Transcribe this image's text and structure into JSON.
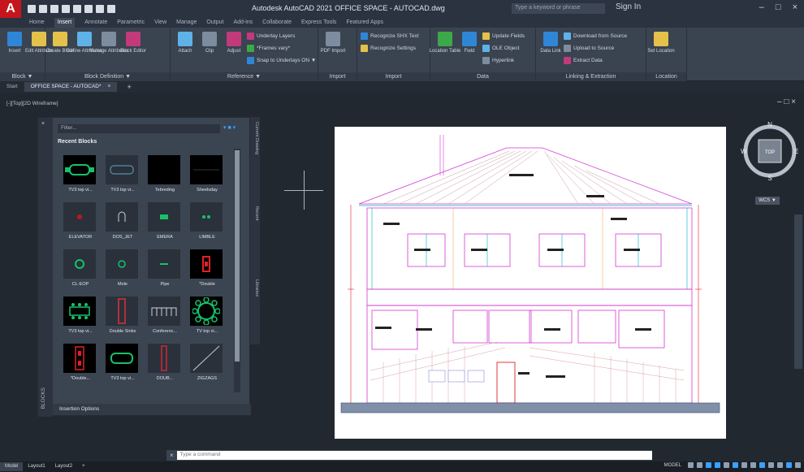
{
  "app": {
    "logo_letter": "A",
    "title": "Autodesk AutoCAD 2021   OFFICE SPACE - AUTOCAD.dwg",
    "search_placeholder": "Type a keyword or phrase",
    "signin": "Sign In",
    "window_controls": [
      "–",
      "□",
      "×"
    ]
  },
  "ribbon_tabs": [
    "Home",
    "Insert",
    "Annotate",
    "Parametric",
    "View",
    "Manage",
    "Output",
    "Add-ins",
    "Collaborate",
    "Express Tools",
    "Featured Apps"
  ],
  "active_ribbon_tab": "Insert",
  "ribbon_groups": [
    {
      "label": "Block ▼",
      "buttons": [
        "Insert",
        "Edit Attribute"
      ]
    },
    {
      "label": "Block Definition ▼",
      "buttons": [
        "Create Block",
        "Define Attributes",
        "Manage Attributes",
        "Block Editor"
      ]
    },
    {
      "label": "Reference ▼",
      "buttons": [
        "Attach",
        "Clip",
        "Adjust"
      ],
      "small": [
        "Underlay Layers",
        "*Frames vary*",
        "Snap to Underlays ON ▼"
      ]
    },
    {
      "label": "Import",
      "buttons": [
        "PDF Import"
      ]
    },
    {
      "label": "Import",
      "small": [
        "Recognize SHX Text",
        "Recognize Settings"
      ]
    },
    {
      "label": "Data",
      "buttons": [
        "Location Table",
        "Field"
      ],
      "small": [
        "Update Fields",
        "OLE Object",
        "Hyperlink"
      ]
    },
    {
      "label": "Linking & Extraction",
      "buttons": [
        "Data Link"
      ],
      "small": [
        "Download from Source",
        "Upload to Source",
        "Extract Data"
      ]
    },
    {
      "label": "Location",
      "buttons": [
        "Set Location"
      ]
    }
  ],
  "file_tabs": {
    "start": "Start",
    "active": "OFFICE SPACE - AUTOCAD*",
    "close": "×",
    "add": "+"
  },
  "viewport_label": "[-][Top][2D Wireframe]",
  "viewport_ctrl": "– □ ×",
  "blocks_palette": {
    "close": "×",
    "title": "BLOCKS",
    "filter_placeholder": "Filter...",
    "section": "Recent Blocks",
    "insertion_options": "Insertion Options",
    "side_tabs": [
      "Current Drawing",
      "Recent",
      "Libraries"
    ],
    "blocks": [
      {
        "label": "TV3 top vi...",
        "icon": "sofa-top",
        "dark": true
      },
      {
        "label": "TV3 top vi...",
        "icon": "sofa-top-alt",
        "dark": false
      },
      {
        "label": "Tebreding",
        "icon": "blank",
        "dark": true
      },
      {
        "label": "Sheelsday",
        "icon": "blank-line",
        "dark": true
      },
      {
        "label": "ELEVATOR",
        "icon": "elevator",
        "dark": false
      },
      {
        "label": "DOS_JET",
        "icon": "door-jet",
        "dark": false
      },
      {
        "label": "EMERA",
        "icon": "camera-mark",
        "dark": false
      },
      {
        "label": "LIMBLE",
        "icon": "dots",
        "dark": false
      },
      {
        "label": "CL-EOP",
        "icon": "ring",
        "dark": false
      },
      {
        "label": "Mole",
        "icon": "ring-small",
        "dark": false
      },
      {
        "label": "Pipe",
        "icon": "pipe",
        "dark": false
      },
      {
        "label": "*Double",
        "icon": "red-block",
        "dark": true
      },
      {
        "label": "TV3 top vi...",
        "icon": "table-green",
        "dark": true
      },
      {
        "label": "Double Sinks",
        "icon": "sink-red",
        "dark": false
      },
      {
        "label": "Conferenc...",
        "icon": "chair-row",
        "dark": false
      },
      {
        "label": "TV top vi...",
        "icon": "round-table",
        "dark": true
      },
      {
        "label": "*Double...",
        "icon": "red-double",
        "dark": true
      },
      {
        "label": "TV3 top vi...",
        "icon": "sofa-green",
        "dark": true
      },
      {
        "label": "DOUB...",
        "icon": "red-column",
        "dark": false
      },
      {
        "label": "ZIGZAGS",
        "icon": "diagonal",
        "dark": false
      }
    ]
  },
  "wcs_label": "WCS ▼",
  "viewcube": {
    "north": "N",
    "south": "S",
    "west": "W",
    "east": "E",
    "face": "TOP"
  },
  "command_line": {
    "close": "×",
    "placeholder": "Type a command"
  },
  "status_bar": {
    "tabs": [
      "Model",
      "Layout1",
      "Layout2",
      "+"
    ],
    "active_tab": "Model",
    "mode": "MODEL"
  },
  "colors": {
    "accent": "#3aa0ff",
    "logo": "#c4161c",
    "drawing_magenta": "#d23ad2",
    "drawing_cyan": "#00b4c8",
    "drawing_red": "#e0202a",
    "block_green": "#15c26b"
  }
}
